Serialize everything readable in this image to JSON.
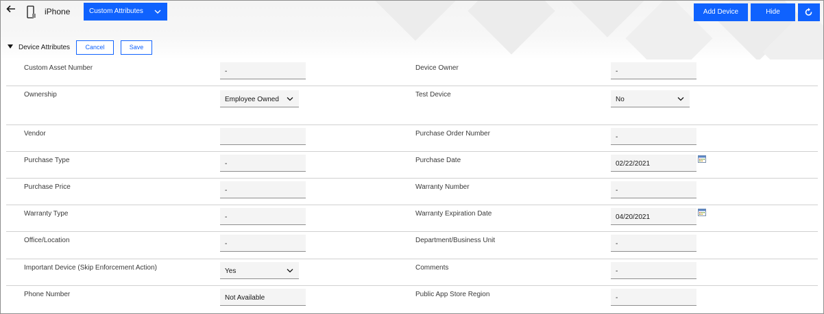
{
  "header": {
    "device_name": "iPhone",
    "view_select": "Custom Attributes",
    "add_device_label": "Add Device",
    "hide_label": "Hide"
  },
  "section": {
    "title": "Device Attributes",
    "cancel_label": "Cancel",
    "save_label": "Save"
  },
  "rows": [
    {
      "left": {
        "label": "Custom Asset Number",
        "value": "-",
        "type": "input"
      },
      "right": {
        "label": "Device Owner",
        "value": "-",
        "type": "input"
      }
    },
    {
      "left": {
        "label": "Ownership",
        "value": "Employee Owned",
        "type": "select"
      },
      "right": {
        "label": "Test Device",
        "value": "No",
        "type": "select"
      }
    },
    {
      "left": {
        "label": "Vendor",
        "value": "",
        "type": "input"
      },
      "right": {
        "label": "Purchase Order Number",
        "value": "-",
        "type": "input"
      }
    },
    {
      "left": {
        "label": "Purchase Type",
        "value": "-",
        "type": "input"
      },
      "right": {
        "label": "Purchase Date",
        "value": "02/22/2021",
        "type": "date"
      }
    },
    {
      "left": {
        "label": "Purchase Price",
        "value": "-",
        "type": "input"
      },
      "right": {
        "label": "Warranty Number",
        "value": "-",
        "type": "input"
      }
    },
    {
      "left": {
        "label": "Warranty Type",
        "value": "-",
        "type": "input"
      },
      "right": {
        "label": "Warranty Expiration Date",
        "value": "04/20/2021",
        "type": "date"
      }
    },
    {
      "left": {
        "label": "Office/Location",
        "value": "-",
        "type": "input"
      },
      "right": {
        "label": "Department/Business Unit",
        "value": "-",
        "type": "input"
      }
    },
    {
      "left": {
        "label": "Important Device (Skip Enforcement Action)",
        "value": "Yes",
        "type": "select"
      },
      "right": {
        "label": "Comments",
        "value": "-",
        "type": "input"
      }
    },
    {
      "left": {
        "label": "Phone Number",
        "value": "Not Available",
        "type": "input"
      },
      "right": {
        "label": "Public App Store Region",
        "value": "-",
        "type": "input"
      }
    }
  ],
  "colors": {
    "accent": "#0f62fe",
    "field_bg": "#f4f4f4",
    "divider": "#d0d0d0"
  }
}
